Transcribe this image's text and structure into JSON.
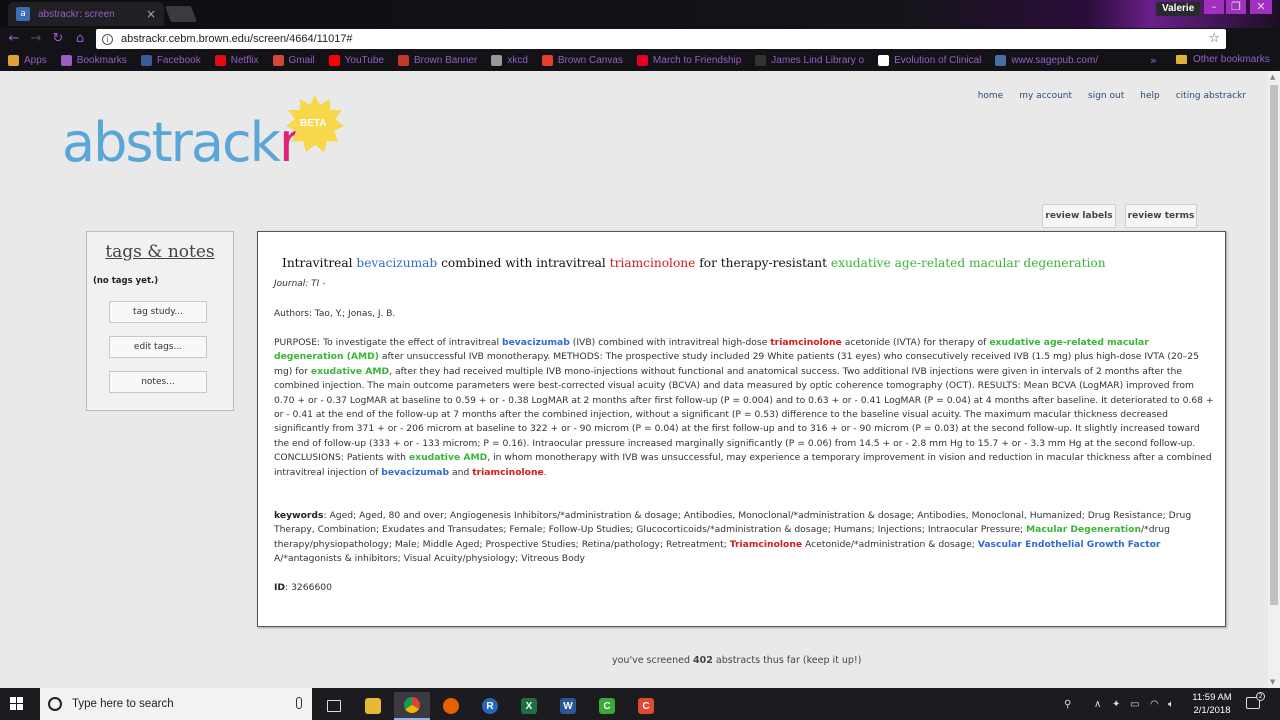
{
  "browser": {
    "tab_title": "abstrackr: screen",
    "user": "Valerie",
    "url": "abstrackr.cebm.brown.edu/screen/4664/11017#",
    "bookmarks": [
      {
        "label": "Apps",
        "icon": "apps-grid-icon",
        "color": "#e0a03a"
      },
      {
        "label": "Bookmarks",
        "icon": "star-icon",
        "color": "#9b5cc8"
      },
      {
        "label": "Facebook",
        "icon": "facebook-icon",
        "color": "#3b5998"
      },
      {
        "label": "Netflix",
        "icon": "netflix-icon",
        "color": "#e50914"
      },
      {
        "label": "Gmail",
        "icon": "gmail-icon",
        "color": "#d44638"
      },
      {
        "label": "YouTube",
        "icon": "youtube-icon",
        "color": "#ff0000"
      },
      {
        "label": "Brown Banner",
        "icon": "brown-shield-icon",
        "color": "#c0392b"
      },
      {
        "label": "xkcd",
        "icon": "xkcd-icon",
        "color": "#999999"
      },
      {
        "label": "Brown Canvas",
        "icon": "canvas-icon",
        "color": "#e63e2c"
      },
      {
        "label": "March to Friendship",
        "icon": "pinterest-icon",
        "color": "#e60023"
      },
      {
        "label": "James Lind Library o",
        "icon": "j-icon",
        "color": "#333333"
      },
      {
        "label": "Evolution of Clinical",
        "icon": "doc-icon",
        "color": "#ffffff"
      },
      {
        "label": "www.sagepub.com/",
        "icon": "sage-icon",
        "color": "#4a6fa5"
      }
    ],
    "other_bookmarks": "Other bookmarks"
  },
  "site": {
    "logo_main": "abstrack",
    "logo_r": "r",
    "beta": "BETA",
    "nav": [
      "home",
      "my account",
      "sign out",
      "help",
      "citing abstrackr"
    ],
    "review_labels": "review labels",
    "review_terms": "review terms"
  },
  "tags": {
    "title": "tags & notes",
    "empty": "(no tags yet.)",
    "tag_study": "tag study...",
    "edit_tags": "edit tags...",
    "notes": "notes..."
  },
  "abstract": {
    "title": {
      "t1": "Intravitreal ",
      "t2": "bevacizumab",
      "t3": " combined with intravitreal ",
      "t4": "triamcinolone",
      "t5": " for therapy-resistant ",
      "t6": "exudative age-related macular degeneration"
    },
    "journal": "Journal: TI -",
    "authors": "Authors: Tao, Y.; Jonas, J. B.",
    "body": {
      "p1": "PURPOSE: To investigate the effect of intravitreal ",
      "h1": "bevacizumab",
      "p2": " (IVB) combined with intravitreal high-dose ",
      "h2": "triamcinolone",
      "p3": " acetonide (IVTA) for therapy of ",
      "h3": "exudative age-related macular degeneration (AMD)",
      "p4": " after unsuccessful IVB monotherapy. METHODS: The prospective study included 29 White patients (31 eyes) who consecutively received IVB (1.5 mg) plus high-dose IVTA (20–25 mg) for ",
      "h4": "exudative AMD",
      "p5": ", after they had received multiple IVB mono-injections without functional and anatomical success. Two additional IVB injections were given in intervals of 2 months after the combined injection. The main outcome parameters were best-corrected visual acuity (BCVA) and data measured by optic coherence tomography (OCT). RESULTS: Mean BCVA (LogMAR) improved from 0.70 + or - 0.37 LogMAR at baseline to 0.59 + or - 0.38 LogMAR at 2 months after first follow-up (P = 0.004) and to 0.63 + or - 0.41 LogMAR (P = 0.04) at 4 months after baseline. It deteriorated to 0.68 + or - 0.41 at the end of the follow-up at 7 months after the combined injection, without a significant (P = 0.53) difference to the baseline visual acuity. The maximum macular thickness decreased significantly from 371 + or - 206 microm at baseline to 322 + or - 90 microm (P = 0.04) at the first follow-up and to 316 + or - 90 microm (P = 0.03) at the second follow-up. It slightly increased toward the end of follow-up (333 + or - 133 microm; P = 0.16). Intraocular pressure increased marginally significantly (P = 0.06) from 14.5 + or - 2.8 mm Hg to 15.7 + or - 3.3 mm Hg at the second follow-up. CONCLUSIONS: Patients with ",
      "h5": "exudative AMD",
      "p6": ", in whom monotherapy with IVB was unsuccessful, may experience a temporary improvement in vision and reduction in macular thickness after a combined intravitreal injection of ",
      "h6": "bevacizumab",
      "p7": " and ",
      "h7": "triamcinolone",
      "p8": "."
    },
    "keywords": {
      "label": "keywords",
      "k1": ": Aged; Aged, 80 and over; Angiogenesis Inhibitors/*administration & dosage; Antibodies, Monoclonal/*administration & dosage; Antibodies, Monoclonal, Humanized; Drug Resistance; Drug Therapy, Combination; Exudates and Transudates; Female; Follow-Up Studies; Glucocorticoids/*administration & dosage; Humans; Injections; Intraocular Pressure; ",
      "h1": "Macular Degeneration",
      "k2": "/*drug therapy/physiopathology; Male; Middle Aged; Prospective Studies; Retina/pathology; Retreatment; ",
      "h2": "Triamcinolone",
      "k3": " Acetonide/*administration & dosage; ",
      "h3": "Vascular Endothelial Growth Factor",
      "k4": " A/*antagonists & inhibitors; Visual Acuity/physiology; Vitreous Body"
    },
    "id_label": "ID",
    "id_value": ": 3266600"
  },
  "progress": {
    "pre": "you've screened ",
    "count": "402",
    "post": " abstracts thus far (keep it up!)"
  },
  "taskbar": {
    "search_placeholder": "Type here to search",
    "time": "11:59 AM",
    "date": "2/1/2018"
  },
  "colors": {
    "positive_term": "#2f6bd0",
    "negative_term": "#d41a1a",
    "condition_term": "#3ab53a",
    "logo_blue": "#5aa6d9",
    "logo_pink": "#e0217a"
  }
}
